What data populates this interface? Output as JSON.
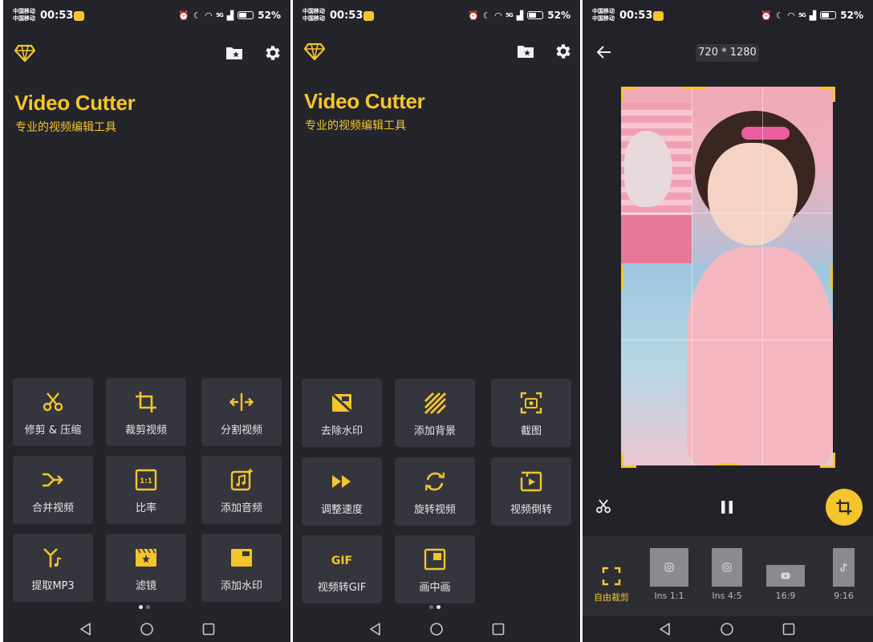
{
  "status_bar": {
    "carrier": "中国移动\n中国移动",
    "time": "00:53",
    "signal_label": "5G",
    "battery": "52%"
  },
  "home": {
    "title": "Video Cutter",
    "subtitle": "专业的视频编辑工具",
    "page1_tools": [
      {
        "label": "修剪 & 压缩",
        "icon": "scissors-icon"
      },
      {
        "label": "裁剪视频",
        "icon": "crop-icon"
      },
      {
        "label": "分割视频",
        "icon": "split-icon"
      },
      {
        "label": "合并视频",
        "icon": "merge-icon"
      },
      {
        "label": "比率",
        "icon": "ratio-icon"
      },
      {
        "label": "添加音频",
        "icon": "music-icon"
      },
      {
        "label": "提取MP3",
        "icon": "extract-audio-icon"
      },
      {
        "label": "滤镜",
        "icon": "filter-icon"
      },
      {
        "label": "添加水印",
        "icon": "watermark-icon"
      }
    ],
    "page2_tools": [
      {
        "label": "去除水印",
        "icon": "remove-watermark-icon"
      },
      {
        "label": "添加背景",
        "icon": "background-icon"
      },
      {
        "label": "截图",
        "icon": "screenshot-icon"
      },
      {
        "label": "调整速度",
        "icon": "speed-icon"
      },
      {
        "label": "旋转视频",
        "icon": "rotate-icon"
      },
      {
        "label": "视频倒转",
        "icon": "reverse-icon"
      },
      {
        "label": "视频转GIF",
        "icon": "gif-icon"
      },
      {
        "label": "画中画",
        "icon": "pip-icon"
      }
    ],
    "gif_glyph": "GIF",
    "ratio_glyph": "1:1"
  },
  "editor": {
    "resolution": "720 * 1280",
    "ratios": [
      {
        "label": "自由裁剪",
        "icon": "free-crop-icon",
        "active": true
      },
      {
        "label": "Ins 1:1",
        "icon": "instagram-icon",
        "active": false
      },
      {
        "label": "Ins 4:5",
        "icon": "instagram-icon",
        "active": false
      },
      {
        "label": "16:9",
        "icon": "youtube-icon",
        "active": false
      },
      {
        "label": "9:16",
        "icon": "tiktok-icon",
        "active": false
      }
    ]
  },
  "colors": {
    "accent": "#f4c52c",
    "background": "#24242b",
    "tile": "#35353d"
  }
}
